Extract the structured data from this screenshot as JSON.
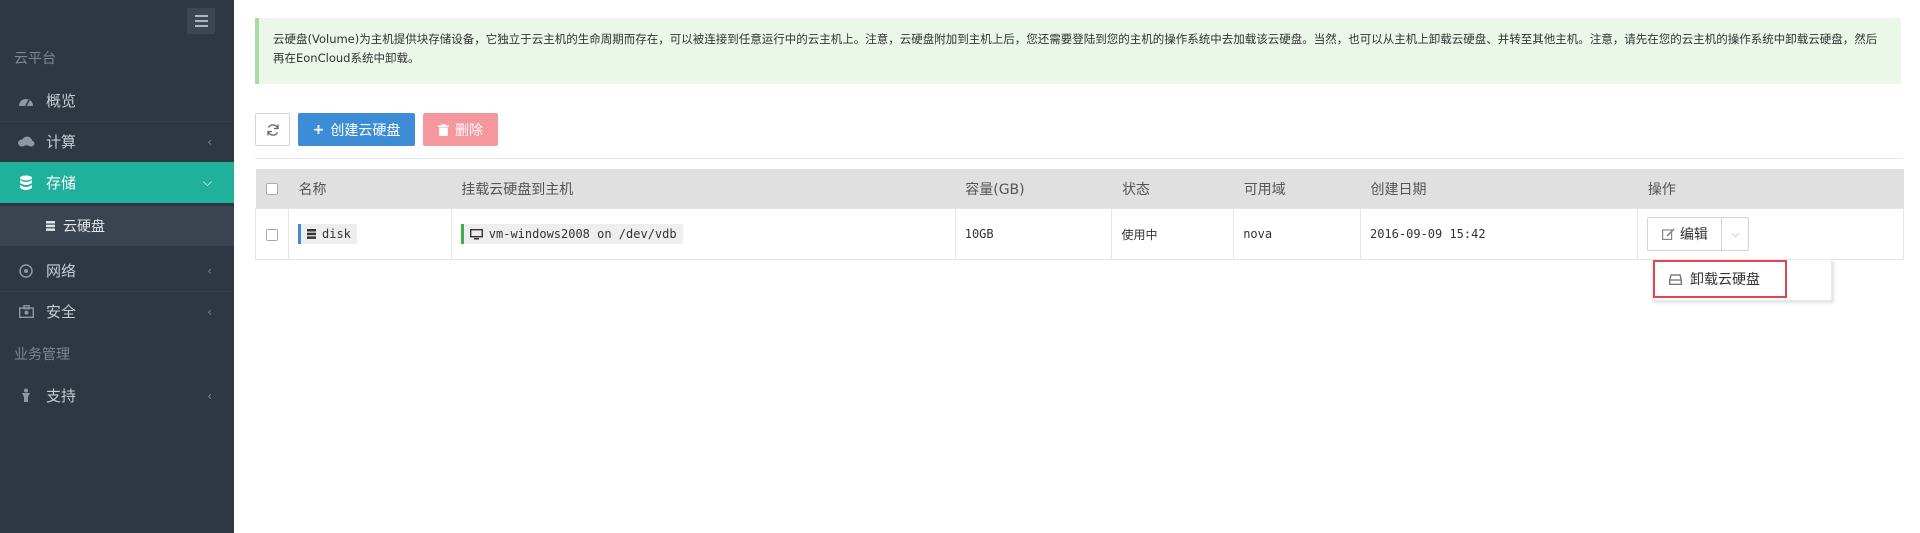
{
  "sidebar": {
    "section_cloud": "云平台",
    "nav": [
      {
        "label": "概览",
        "icon": "dashboard-icon"
      },
      {
        "label": "计算",
        "icon": "cloud-icon"
      },
      {
        "label": "存储",
        "icon": "database-icon"
      },
      {
        "label": "网络",
        "icon": "network-icon"
      },
      {
        "label": "安全",
        "icon": "security-icon"
      },
      {
        "label": "支持",
        "icon": "support-icon"
      }
    ],
    "sub_item": "云硬盘",
    "section_business": "业务管理"
  },
  "alert": {
    "text": "云硬盘(Volume)为主机提供块存储设备，它独立于云主机的生命周期而存在，可以被连接到任意运行中的云主机上。注意，云硬盘附加到主机上后，您还需要登陆到您的主机的操作系统中去加载该云硬盘。当然，也可以从主机上卸载云硬盘、并转至其他主机。注意，请先在您的云主机的操作系统中卸载云硬盘，然后再在EonCloud系统中卸载。"
  },
  "toolbar": {
    "create_label": "创建云硬盘",
    "delete_label": "删除"
  },
  "table": {
    "headers": [
      "名称",
      "挂载云硬盘到主机",
      "容量(GB)",
      "状态",
      "可用域",
      "创建日期",
      "操作"
    ],
    "rows": [
      {
        "name": "disk",
        "attached": "vm-windows2008 on /dev/vdb",
        "size": "10GB",
        "status": "使用中",
        "zone": "nova",
        "created": "2016-09-09 15:42",
        "action": "编辑"
      }
    ]
  },
  "dropdown": {
    "detach_label": "卸载云硬盘"
  },
  "colors": {
    "sidebar_bg": "#2e3742",
    "active": "#1fb19b",
    "primary": "#3c8dd6",
    "danger": "#f4989d"
  }
}
